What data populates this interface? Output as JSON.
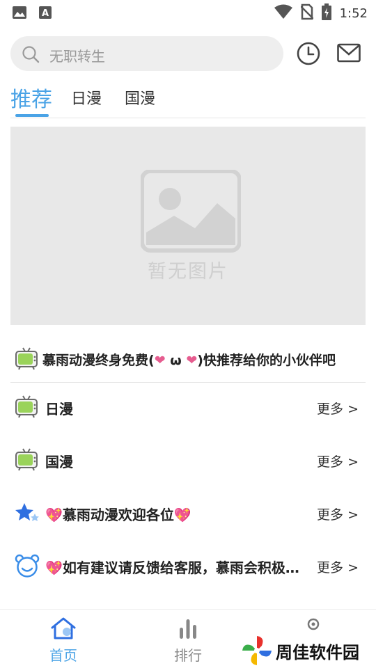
{
  "status_bar": {
    "time": "1:52"
  },
  "search": {
    "placeholder": "无职转生"
  },
  "tabs": [
    {
      "label": "推荐",
      "active": true
    },
    {
      "label": "日漫",
      "active": false
    },
    {
      "label": "国漫",
      "active": false
    }
  ],
  "banner": {
    "placeholder_text": "暂无图片"
  },
  "notice": {
    "prefix": "慕雨动漫终身免费(",
    "mid": " ω ",
    "suffix": ")快推荐给你的小伙伴吧",
    "heart": "❤"
  },
  "sections": [
    {
      "title": "日漫",
      "more": "更多 >",
      "icon": "tv-icon"
    },
    {
      "title": "国漫",
      "more": "更多 >",
      "icon": "tv-icon"
    },
    {
      "title": "💖慕雨动漫欢迎各位💖",
      "more": "更多 >",
      "icon": "star-icon"
    },
    {
      "title": "💖如有建议请反馈给客服，慕雨会积极改进",
      "more": "更多 >",
      "icon": "bear-icon"
    }
  ],
  "bottom_nav": [
    {
      "label": "首页",
      "icon": "home-icon",
      "active": true
    },
    {
      "label": "排行",
      "icon": "rank-icon",
      "active": false
    }
  ],
  "watermark": {
    "text": "周佳软件园"
  },
  "colors": {
    "accent": "#4aa3e6",
    "heart": "#e65c8f"
  }
}
